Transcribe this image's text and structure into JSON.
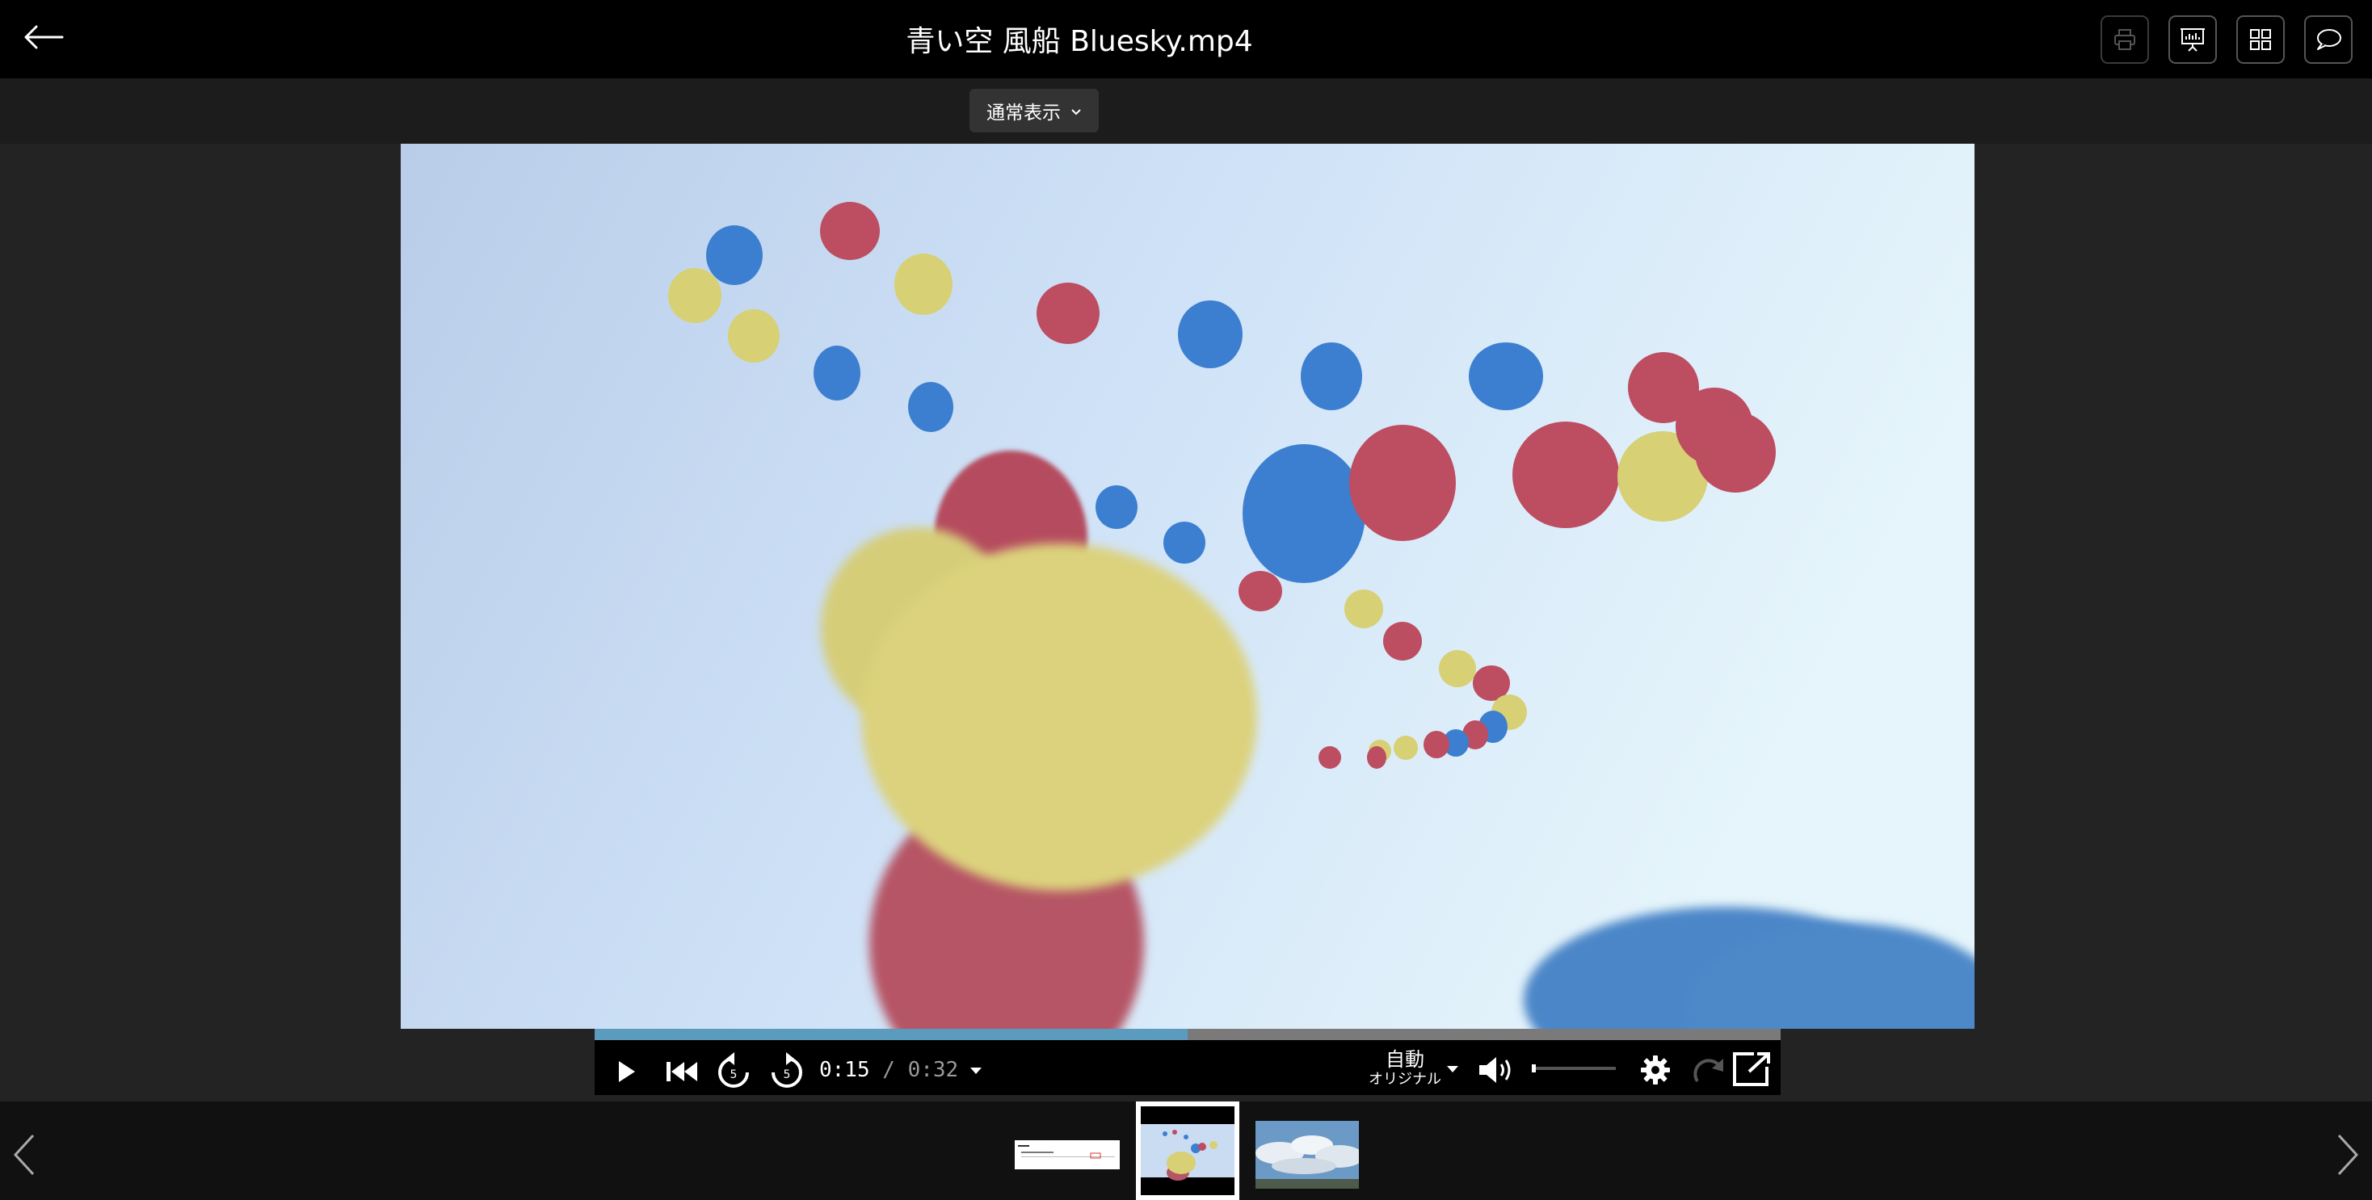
{
  "header": {
    "title": "青い空 風船 Bluesky.mp4"
  },
  "toolbar": {
    "view_mode": "通常表示"
  },
  "player": {
    "current_time": "0:15",
    "separator": "/",
    "duration": "0:32",
    "progress": 0.5,
    "quality_mode": "自動",
    "quality_sub": "オリジナル",
    "volume": 0.05
  },
  "filmstrip": {
    "active_index": 1,
    "count": 3
  },
  "colors": {
    "progress_fill": "#5b9bbd",
    "header_bg": "#000000",
    "stage_bg": "#232323"
  }
}
